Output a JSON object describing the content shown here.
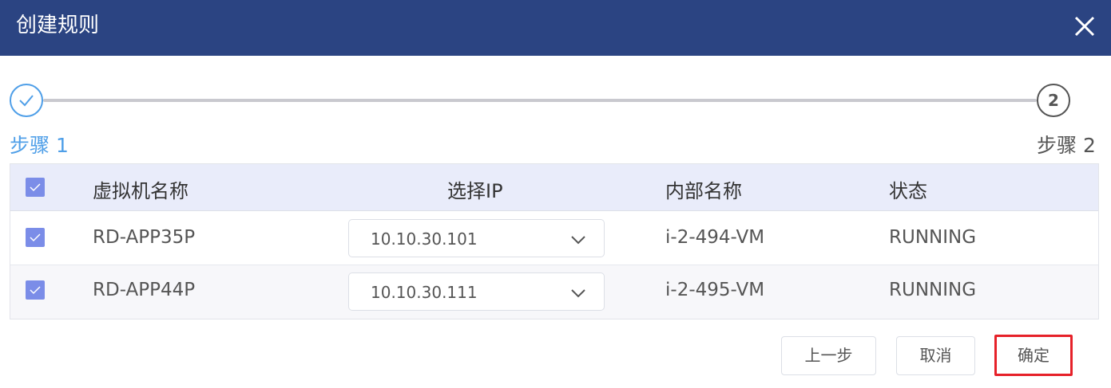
{
  "dialog": {
    "title": "创建规则"
  },
  "steps": [
    {
      "label": "步骤 1",
      "state": "done"
    },
    {
      "label": "步骤 2",
      "number": "2",
      "state": "current"
    }
  ],
  "table": {
    "headers": [
      "虚拟机名称",
      "选择IP",
      "内部名称",
      "状态"
    ],
    "header_checked": true,
    "rows": [
      {
        "checked": true,
        "name": "RD-APP35P",
        "ip": "10.10.30.101",
        "internal_name": "i-2-494-VM",
        "status": "RUNNING"
      },
      {
        "checked": true,
        "name": "RD-APP44P",
        "ip": "10.10.30.111",
        "internal_name": "i-2-495-VM",
        "status": "RUNNING"
      }
    ]
  },
  "footer": {
    "prev_label": "上一步",
    "cancel_label": "取消",
    "confirm_label": "确定"
  },
  "colors": {
    "header_bg": "#2b4482",
    "step_active": "#4f9fe8",
    "checkbox": "#7b8de8",
    "highlight_border": "#e62129"
  }
}
